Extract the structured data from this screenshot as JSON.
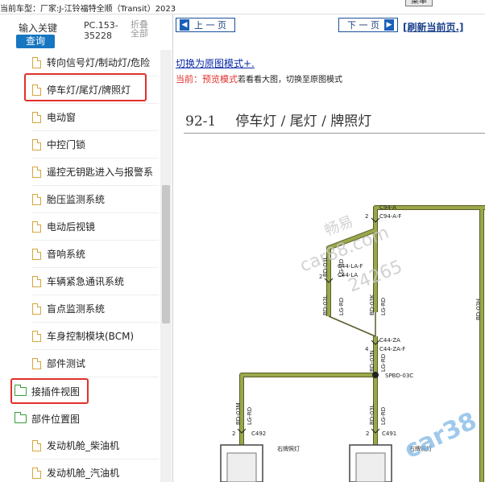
{
  "topbar": {
    "vehicle": "当前车型：厂家:J-江铃福特全顺（Transit）2023",
    "corner_button": "菜单"
  },
  "sidebar": {
    "keyword_label": "输入关键",
    "query_button": "查询",
    "pc_code_line1": "PC.153-",
    "pc_code_line2": "35228",
    "fold_line1": "折叠",
    "fold_line2": "全部",
    "items": [
      {
        "label": "转向信号灯/制动灯/危险",
        "type": "file"
      },
      {
        "label": "停车灯/尾灯/牌照灯",
        "type": "file"
      },
      {
        "label": "电动窗",
        "type": "file"
      },
      {
        "label": "中控门锁",
        "type": "file"
      },
      {
        "label": "遥控无钥匙进入与报警系",
        "type": "file"
      },
      {
        "label": "胎压监测系统",
        "type": "file"
      },
      {
        "label": "电动后视镜",
        "type": "file"
      },
      {
        "label": "音响系统",
        "type": "file"
      },
      {
        "label": "车辆紧急通讯系统",
        "type": "file"
      },
      {
        "label": "盲点监测系统",
        "type": "file"
      },
      {
        "label": "车身控制模块(BCM)",
        "type": "file"
      },
      {
        "label": "部件测试",
        "type": "file"
      },
      {
        "label": "接插件视图",
        "type": "folder"
      },
      {
        "label": "部件位置图",
        "type": "folder"
      },
      {
        "label": "发动机舱_柴油机",
        "type": "file"
      },
      {
        "label": "发动机舱_汽油机",
        "type": "file"
      }
    ]
  },
  "content": {
    "prev_button": "上 一 页",
    "next_button": "下 一 页",
    "refresh_link": "[刷新当前页.]",
    "mode_link": "切换为原图模式+.",
    "current_label": "当前：",
    "current_mode": "预览模式",
    "current_hint": "若看看大图，切换至原图模式",
    "section_number": "92-1",
    "section_title": "停车灯 / 尾灯 / 牌照灯"
  },
  "diagram": {
    "wire_color": "#9aa84a",
    "labels": {
      "c94a": "C94-A",
      "c94af": "C94-A-F",
      "pin2a": "2",
      "bd03l_top": "BD-03L",
      "lgrd_a": "LG-RD",
      "c44laf": "C44-LA-F",
      "c44la": "C44-LA",
      "pin2b": "2",
      "bd03l_mid": "BD-03L",
      "lgrd_b": "LG-RD",
      "bd03k": "BD-03K",
      "lgrd_c": "LG-RD",
      "c44za": "C44-ZA",
      "c44zaf": "C44-ZA-F",
      "pin4": "4",
      "bd03n": "BD-03N",
      "lgrd_d": "LG-RD",
      "splice": "SPBD-03C",
      "bd03m": "BD-03M",
      "lgrd_e": "LG-RD",
      "bd03lb": "BD-03L",
      "lgrd_f": "LG-RD",
      "pin2c": "2",
      "c492": "C492",
      "pin2d": "2",
      "c491": "C491",
      "right_lamp": "右牌照灯",
      "bd03h": "BD-03H"
    }
  },
  "watermark": {
    "line1": "畅易",
    "line2": "car88.com",
    "line3": "24265",
    "corner": "car38"
  }
}
